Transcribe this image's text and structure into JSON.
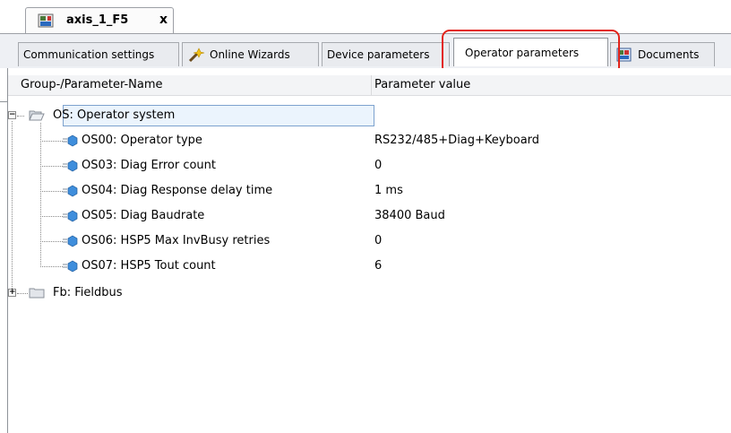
{
  "document_tab": {
    "title": "axis_1_F5",
    "close": "x"
  },
  "tabs": [
    {
      "label": "Communication settings"
    },
    {
      "label": "Online Wizards"
    },
    {
      "label": "Device parameters"
    },
    {
      "label": "Operator parameters"
    },
    {
      "label": "Documents"
    }
  ],
  "columns": {
    "name": "Group-/Parameter-Name",
    "value": "Parameter value"
  },
  "groups": [
    {
      "name": "OS: Operator system",
      "expanded": true,
      "params": [
        {
          "name": "OS00: Operator type",
          "value": "RS232/485+Diag+Keyboard"
        },
        {
          "name": "OS03: Diag Error count",
          "value": "0"
        },
        {
          "name": "OS04: Diag Response delay time",
          "value": "1 ms"
        },
        {
          "name": "OS05: Diag Baudrate",
          "value": "38400 Baud"
        },
        {
          "name": "OS06: HSP5 Max InvBusy retries",
          "value": "0"
        },
        {
          "name": "OS07: HSP5 Tout count",
          "value": "6"
        }
      ]
    },
    {
      "name": "Fb: Fieldbus",
      "expanded": false
    }
  ],
  "colors": {
    "highlight": "#e2231a",
    "selection": "#ebf4fd"
  }
}
